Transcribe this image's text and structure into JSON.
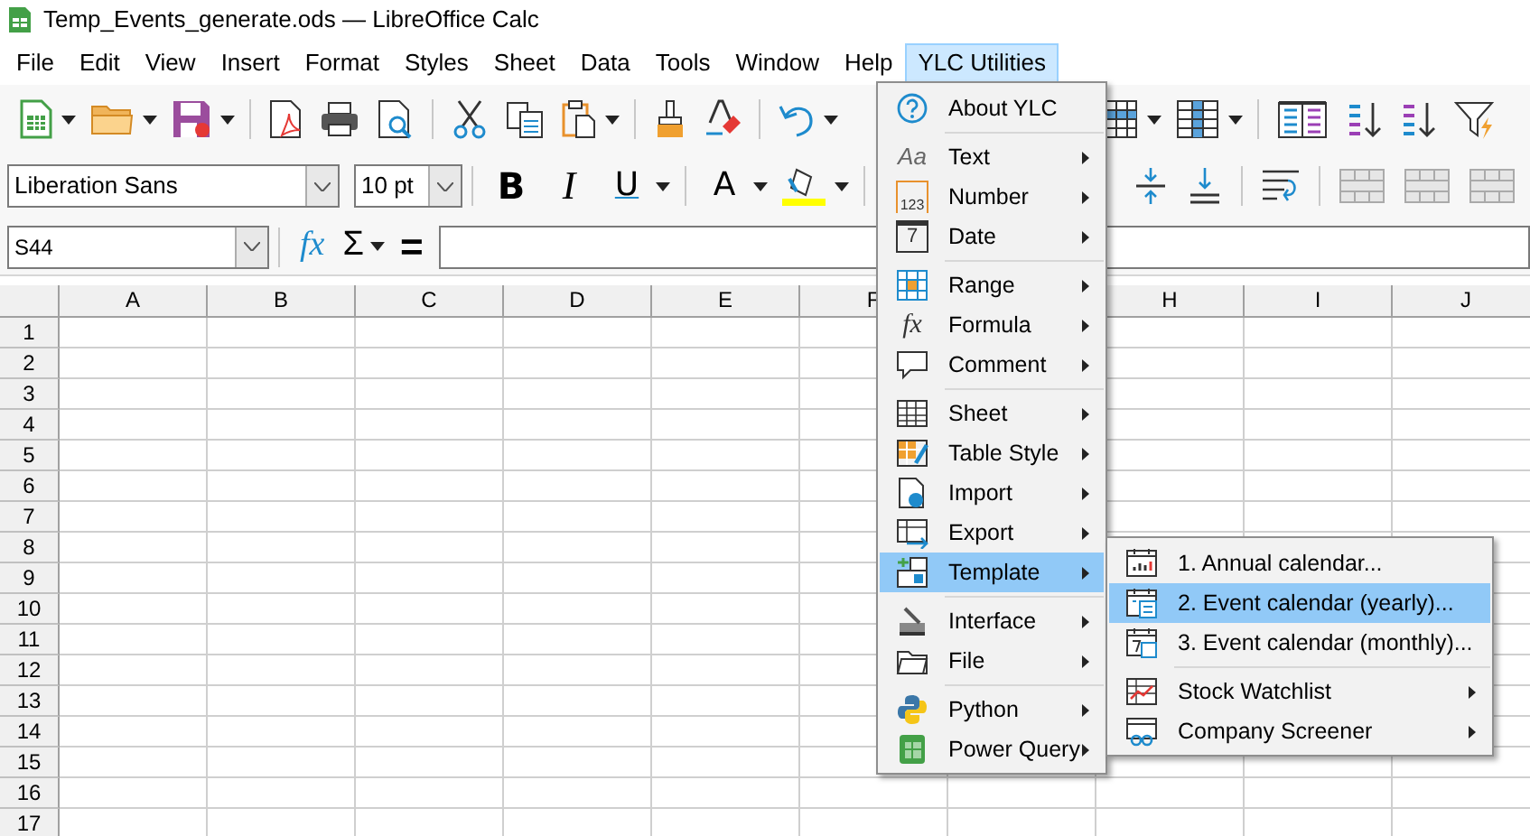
{
  "window": {
    "title": "Temp_Events_generate.ods — LibreOffice Calc"
  },
  "menu_bar": [
    {
      "label": "File",
      "selected": false
    },
    {
      "label": "Edit",
      "selected": false
    },
    {
      "label": "View",
      "selected": false
    },
    {
      "label": "Insert",
      "selected": false
    },
    {
      "label": "Format",
      "selected": false
    },
    {
      "label": "Styles",
      "selected": false
    },
    {
      "label": "Sheet",
      "selected": false
    },
    {
      "label": "Data",
      "selected": false
    },
    {
      "label": "Tools",
      "selected": false
    },
    {
      "label": "Window",
      "selected": false
    },
    {
      "label": "Help",
      "selected": false
    },
    {
      "label": "YLC Utilities",
      "selected": true
    }
  ],
  "format_toolbar": {
    "font_name": "Liberation Sans",
    "font_size": "10 pt",
    "bold": "B",
    "italic": "I",
    "underline": "U",
    "font_color": "A"
  },
  "formula_bar": {
    "name_box": "S44",
    "function_wizard": "fx",
    "sum": "Σ",
    "equals": "="
  },
  "sheet": {
    "columns_left": [
      "A",
      "B",
      "C",
      "D",
      "E",
      "F"
    ],
    "columns_right": [
      "H",
      "I",
      "J"
    ],
    "rows": [
      "1",
      "2",
      "3",
      "4",
      "5",
      "6",
      "7",
      "8",
      "9",
      "10",
      "11",
      "12",
      "13",
      "14",
      "15",
      "16",
      "17"
    ]
  },
  "ylc_menu": {
    "groups": [
      [
        {
          "label": "About YLC",
          "submenu": false,
          "selected": false
        }
      ],
      [
        {
          "label": "Text",
          "submenu": true,
          "selected": false,
          "glyph": "Aa"
        },
        {
          "label": "Number",
          "submenu": true,
          "selected": false,
          "glyph": "123"
        },
        {
          "label": "Date",
          "submenu": true,
          "selected": false,
          "glyph": "7"
        }
      ],
      [
        {
          "label": "Range",
          "submenu": true,
          "selected": false
        },
        {
          "label": "Formula",
          "submenu": true,
          "selected": false,
          "glyph": "fx"
        },
        {
          "label": "Comment",
          "submenu": true,
          "selected": false
        }
      ],
      [
        {
          "label": "Sheet",
          "submenu": true,
          "selected": false
        },
        {
          "label": "Table Style",
          "submenu": true,
          "selected": false
        },
        {
          "label": "Import",
          "submenu": true,
          "selected": false
        },
        {
          "label": "Export",
          "submenu": true,
          "selected": false
        },
        {
          "label": "Template",
          "submenu": true,
          "selected": true
        }
      ],
      [
        {
          "label": "Interface",
          "submenu": true,
          "selected": false
        },
        {
          "label": "File",
          "submenu": true,
          "selected": false
        }
      ],
      [
        {
          "label": "Python",
          "submenu": true,
          "selected": false
        },
        {
          "label": "Power Query",
          "submenu": true,
          "selected": false
        }
      ]
    ]
  },
  "template_submenu": {
    "groups": [
      [
        {
          "label": "1. Annual calendar...",
          "submenu": false,
          "selected": false
        },
        {
          "label": "2. Event calendar (yearly)...",
          "submenu": false,
          "selected": true
        },
        {
          "label": "3. Event calendar (monthly)...",
          "submenu": false,
          "selected": false
        }
      ],
      [
        {
          "label": "Stock Watchlist",
          "submenu": true,
          "selected": false
        },
        {
          "label": "Company Screener",
          "submenu": true,
          "selected": false
        }
      ]
    ]
  }
}
